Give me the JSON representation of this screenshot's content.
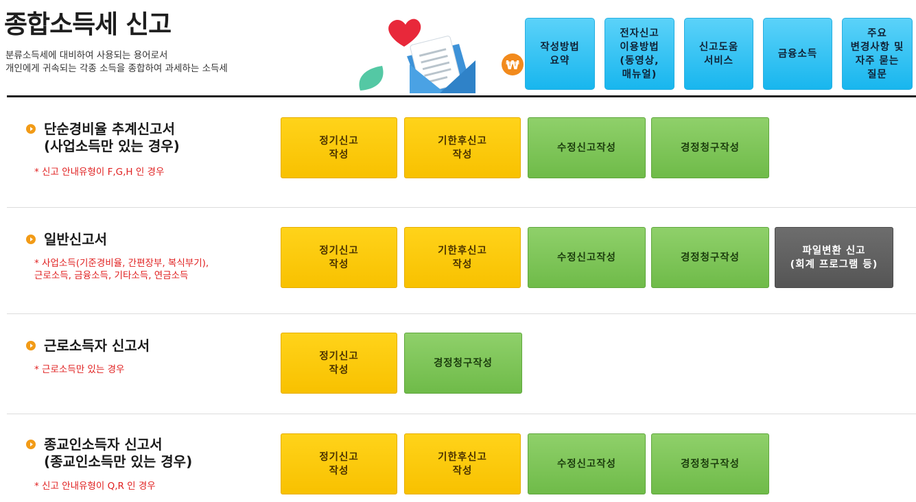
{
  "header": {
    "title": "종합소득세 신고",
    "subtitle_line1": "분류소득세에 대비하여 사용되는 용어로서",
    "subtitle_line2": "개인에게 귀속되는 각종 소득을 종합하여 과세하는 소득세",
    "nav": [
      {
        "label": "작성방법\n요약"
      },
      {
        "label": "전자신고\n이용방법\n(동영상,\n매뉴얼)"
      },
      {
        "label": "신고도움\n서비스"
      },
      {
        "label": "금융소득"
      },
      {
        "label": "주요\n변경사항 및\n자주 묻는\n질문"
      }
    ],
    "illustration_icons": [
      "heart-icon",
      "envelope-icon",
      "won-coin-icon",
      "leaf-icon"
    ]
  },
  "sections": [
    {
      "title": "단순경비율 추계신고서\n(사업소득만 있는 경우)",
      "note": "* 신고 안내유형이 F,G,H 인 경우",
      "buttons": [
        "정기신고\n작성",
        "기한후신고\n작성",
        "수정신고작성",
        "경정청구작성"
      ]
    },
    {
      "title": "일반신고서",
      "note": "* 사업소득(기준경비율, 간편장부, 복식부기),\n근로소득, 금융소득, 기타소득, 연금소득",
      "buttons": [
        "정기신고\n작성",
        "기한후신고\n작성",
        "수정신고작성",
        "경정청구작성",
        "파일변환 신고\n(회계 프로그램 등)"
      ]
    },
    {
      "title": "근로소득자 신고서",
      "note": "* 근로소득만 있는 경우",
      "buttons": [
        "정기신고\n작성",
        "경정청구작성"
      ]
    },
    {
      "title": "종교인소득자 신고서\n(종교인소득만 있는 경우)",
      "note": "* 신고 안내유형이 Q,R 인 경우",
      "buttons": [
        "정기신고\n작성",
        "기한후신고\n작성",
        "수정신고작성",
        "경정청구작성"
      ]
    }
  ],
  "colors": {
    "nav_button": "#18b6ee",
    "primary_button": "#f8c100",
    "secondary_button": "#6fbb49",
    "file_button": "#555555",
    "note_text": "#e02020",
    "bullet": "#f29b17"
  }
}
